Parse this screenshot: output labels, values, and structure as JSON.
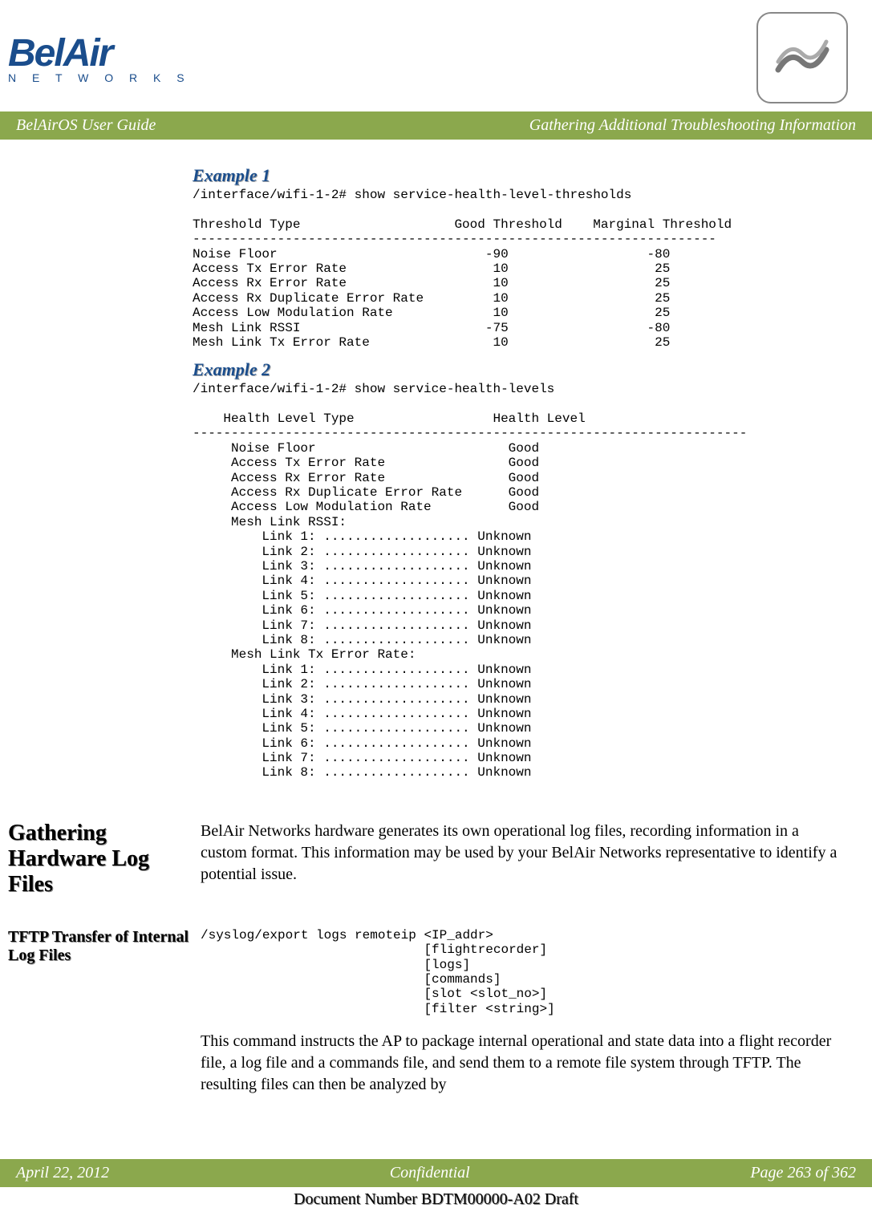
{
  "logo": {
    "brand": "BelAir",
    "subtitle": "N E T W O R K S"
  },
  "banner": {
    "left": "BelAirOS User Guide",
    "right": "Gathering Additional Troubleshooting Information"
  },
  "example1": {
    "heading": "Example 1",
    "text": "/interface/wifi-1-2# show service-health-level-thresholds\n\nThreshold Type                    Good Threshold    Marginal Threshold\n--------------------------------------------------------------------\nNoise Floor                           -90                  -80\nAccess Tx Error Rate                   10                   25\nAccess Rx Error Rate                   10                   25\nAccess Rx Duplicate Error Rate         10                   25\nAccess Low Modulation Rate             10                   25\nMesh Link RSSI                        -75                  -80\nMesh Link Tx Error Rate                10                   25"
  },
  "example2": {
    "heading": "Example 2",
    "text": "/interface/wifi-1-2# show service-health-levels\n\n    Health Level Type                  Health Level\n------------------------------------------------------------------------\n     Noise Floor                         Good\n     Access Tx Error Rate                Good\n     Access Rx Error Rate                Good\n     Access Rx Duplicate Error Rate      Good\n     Access Low Modulation Rate          Good\n     Mesh Link RSSI:\n         Link 1: ................... Unknown\n         Link 2: ................... Unknown\n         Link 3: ................... Unknown\n         Link 4: ................... Unknown\n         Link 5: ................... Unknown\n         Link 6: ................... Unknown\n         Link 7: ................... Unknown\n         Link 8: ................... Unknown\n     Mesh Link Tx Error Rate:\n         Link 1: ................... Unknown\n         Link 2: ................... Unknown\n         Link 3: ................... Unknown\n         Link 4: ................... Unknown\n         Link 5: ................... Unknown\n         Link 6: ................... Unknown\n         Link 7: ................... Unknown\n         Link 8: ................... Unknown"
  },
  "gathering": {
    "heading": "Gathering Hardware Log Files",
    "text": "BelAir Networks hardware generates its own operational log files, recording information in a custom format. This information may be used by your BelAir Networks representative to identify a potential issue."
  },
  "tftp": {
    "heading": "TFTP Transfer of Internal Log Files",
    "command": "/syslog/export logs remoteip <IP_addr>\n                             [flightrecorder]\n                             [logs]\n                             [commands]\n                             [slot <slot_no>]\n                             [filter <string>]",
    "text": "This command instructs the AP to package internal operational and state data into a flight recorder file, a log file and a commands file, and send them to a remote file system through TFTP. The resulting files can then be analyzed by"
  },
  "footer": {
    "date": "April 22, 2012",
    "confidential": "Confidential",
    "page": "Page 263 of 362",
    "docnum": "Document Number BDTM00000-A02 Draft"
  }
}
